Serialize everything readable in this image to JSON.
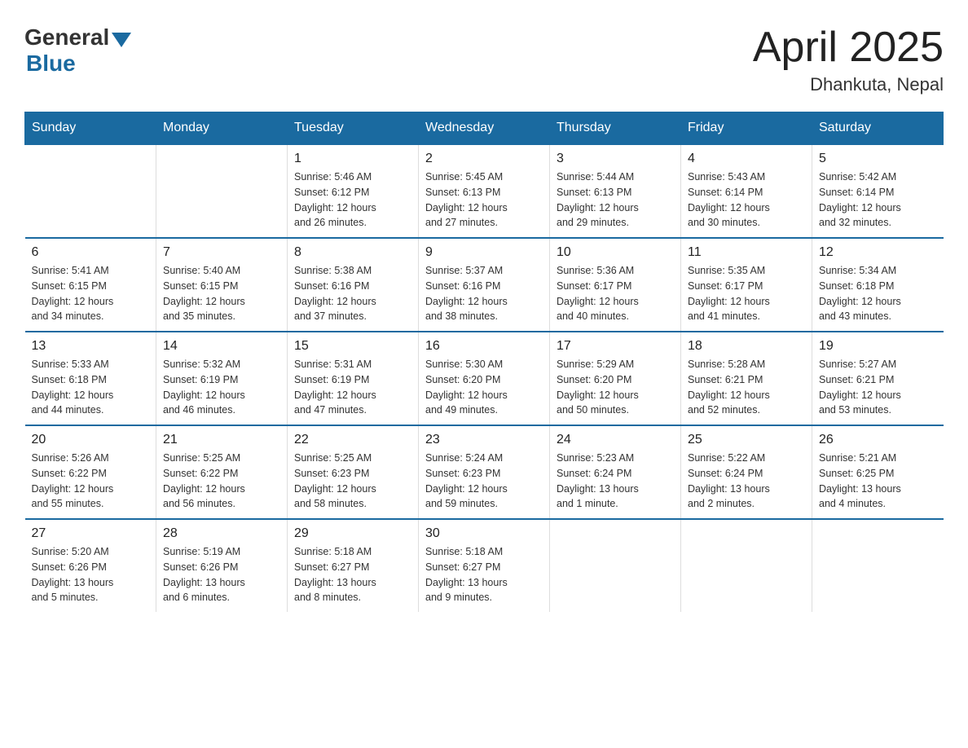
{
  "logo": {
    "general": "General",
    "blue": "Blue"
  },
  "title": "April 2025",
  "subtitle": "Dhankuta, Nepal",
  "weekdays": [
    "Sunday",
    "Monday",
    "Tuesday",
    "Wednesday",
    "Thursday",
    "Friday",
    "Saturday"
  ],
  "weeks": [
    [
      {
        "day": "",
        "info": ""
      },
      {
        "day": "",
        "info": ""
      },
      {
        "day": "1",
        "info": "Sunrise: 5:46 AM\nSunset: 6:12 PM\nDaylight: 12 hours\nand 26 minutes."
      },
      {
        "day": "2",
        "info": "Sunrise: 5:45 AM\nSunset: 6:13 PM\nDaylight: 12 hours\nand 27 minutes."
      },
      {
        "day": "3",
        "info": "Sunrise: 5:44 AM\nSunset: 6:13 PM\nDaylight: 12 hours\nand 29 minutes."
      },
      {
        "day": "4",
        "info": "Sunrise: 5:43 AM\nSunset: 6:14 PM\nDaylight: 12 hours\nand 30 minutes."
      },
      {
        "day": "5",
        "info": "Sunrise: 5:42 AM\nSunset: 6:14 PM\nDaylight: 12 hours\nand 32 minutes."
      }
    ],
    [
      {
        "day": "6",
        "info": "Sunrise: 5:41 AM\nSunset: 6:15 PM\nDaylight: 12 hours\nand 34 minutes."
      },
      {
        "day": "7",
        "info": "Sunrise: 5:40 AM\nSunset: 6:15 PM\nDaylight: 12 hours\nand 35 minutes."
      },
      {
        "day": "8",
        "info": "Sunrise: 5:38 AM\nSunset: 6:16 PM\nDaylight: 12 hours\nand 37 minutes."
      },
      {
        "day": "9",
        "info": "Sunrise: 5:37 AM\nSunset: 6:16 PM\nDaylight: 12 hours\nand 38 minutes."
      },
      {
        "day": "10",
        "info": "Sunrise: 5:36 AM\nSunset: 6:17 PM\nDaylight: 12 hours\nand 40 minutes."
      },
      {
        "day": "11",
        "info": "Sunrise: 5:35 AM\nSunset: 6:17 PM\nDaylight: 12 hours\nand 41 minutes."
      },
      {
        "day": "12",
        "info": "Sunrise: 5:34 AM\nSunset: 6:18 PM\nDaylight: 12 hours\nand 43 minutes."
      }
    ],
    [
      {
        "day": "13",
        "info": "Sunrise: 5:33 AM\nSunset: 6:18 PM\nDaylight: 12 hours\nand 44 minutes."
      },
      {
        "day": "14",
        "info": "Sunrise: 5:32 AM\nSunset: 6:19 PM\nDaylight: 12 hours\nand 46 minutes."
      },
      {
        "day": "15",
        "info": "Sunrise: 5:31 AM\nSunset: 6:19 PM\nDaylight: 12 hours\nand 47 minutes."
      },
      {
        "day": "16",
        "info": "Sunrise: 5:30 AM\nSunset: 6:20 PM\nDaylight: 12 hours\nand 49 minutes."
      },
      {
        "day": "17",
        "info": "Sunrise: 5:29 AM\nSunset: 6:20 PM\nDaylight: 12 hours\nand 50 minutes."
      },
      {
        "day": "18",
        "info": "Sunrise: 5:28 AM\nSunset: 6:21 PM\nDaylight: 12 hours\nand 52 minutes."
      },
      {
        "day": "19",
        "info": "Sunrise: 5:27 AM\nSunset: 6:21 PM\nDaylight: 12 hours\nand 53 minutes."
      }
    ],
    [
      {
        "day": "20",
        "info": "Sunrise: 5:26 AM\nSunset: 6:22 PM\nDaylight: 12 hours\nand 55 minutes."
      },
      {
        "day": "21",
        "info": "Sunrise: 5:25 AM\nSunset: 6:22 PM\nDaylight: 12 hours\nand 56 minutes."
      },
      {
        "day": "22",
        "info": "Sunrise: 5:25 AM\nSunset: 6:23 PM\nDaylight: 12 hours\nand 58 minutes."
      },
      {
        "day": "23",
        "info": "Sunrise: 5:24 AM\nSunset: 6:23 PM\nDaylight: 12 hours\nand 59 minutes."
      },
      {
        "day": "24",
        "info": "Sunrise: 5:23 AM\nSunset: 6:24 PM\nDaylight: 13 hours\nand 1 minute."
      },
      {
        "day": "25",
        "info": "Sunrise: 5:22 AM\nSunset: 6:24 PM\nDaylight: 13 hours\nand 2 minutes."
      },
      {
        "day": "26",
        "info": "Sunrise: 5:21 AM\nSunset: 6:25 PM\nDaylight: 13 hours\nand 4 minutes."
      }
    ],
    [
      {
        "day": "27",
        "info": "Sunrise: 5:20 AM\nSunset: 6:26 PM\nDaylight: 13 hours\nand 5 minutes."
      },
      {
        "day": "28",
        "info": "Sunrise: 5:19 AM\nSunset: 6:26 PM\nDaylight: 13 hours\nand 6 minutes."
      },
      {
        "day": "29",
        "info": "Sunrise: 5:18 AM\nSunset: 6:27 PM\nDaylight: 13 hours\nand 8 minutes."
      },
      {
        "day": "30",
        "info": "Sunrise: 5:18 AM\nSunset: 6:27 PM\nDaylight: 13 hours\nand 9 minutes."
      },
      {
        "day": "",
        "info": ""
      },
      {
        "day": "",
        "info": ""
      },
      {
        "day": "",
        "info": ""
      }
    ]
  ]
}
